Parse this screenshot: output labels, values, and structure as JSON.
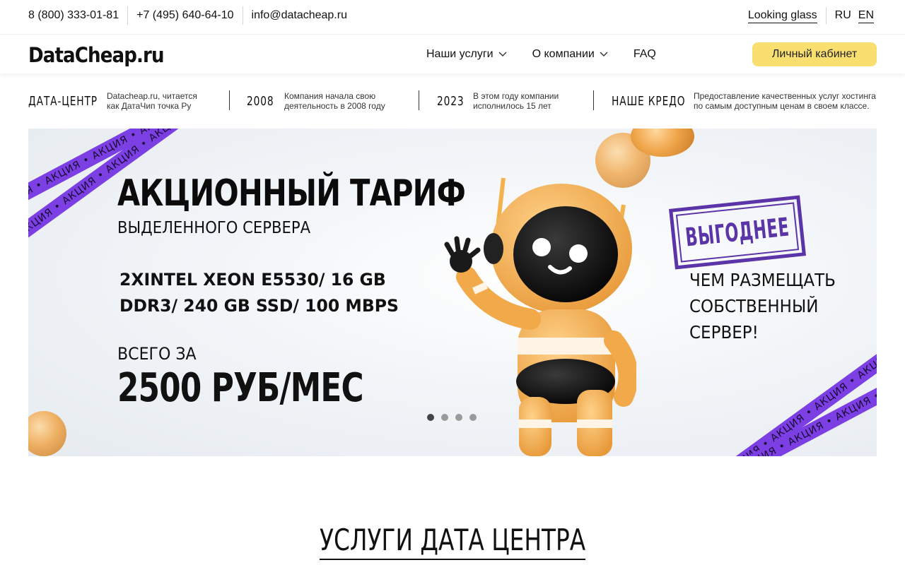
{
  "topbar": {
    "phone1": "8 (800) 333-01-81",
    "phone2": "+7 (495) 640-64-10",
    "email": "info@datacheap.ru",
    "looking_glass": "Looking glass",
    "lang_ru": "RU",
    "lang_en": "EN"
  },
  "header": {
    "logo": "DataCheap.ru",
    "nav": [
      "Наши услуги",
      "О компании",
      "FAQ"
    ],
    "cabinet_label": "Личный кабинет"
  },
  "facts": [
    {
      "big": "ДАТА-ЦЕНТР",
      "small": "Datacheap.ru, читается как ДатаЧип точка Ру"
    },
    {
      "big": "2008",
      "small": "Компания начала свою деятельность в 2008 году"
    },
    {
      "big": "2023",
      "small": "В этом году компании исполнилось 15 лет"
    },
    {
      "big": "НАШЕ КРЕДО",
      "small": "Предоставление качественных услуг хостинга по самым доступным ценам в своем классе."
    }
  ],
  "banner": {
    "title": "АКЦИОННЫЙ ТАРИФ",
    "subtitle": "ВЫДЕЛЕННОГО СЕРВЕРА",
    "spec_line1": "2XINTEL XEON E5530/ 16 GB",
    "spec_line2": "DDR3/ 240 GB SSD/ 100 MBPS",
    "price_prefix": "ВСЕГО ЗА",
    "price": "2500 РУБ/МЕС",
    "stamp": "ВЫГОДНЕЕ",
    "right_line1": "ЧЕМ РАЗМЕЩАТЬ",
    "right_line2": "СОБСТВЕННЫЙ",
    "right_line3": "СЕРВЕР!",
    "ribbon_text": "АКЦИЯ  •  АКЦИЯ  •  АКЦИЯ  •  АКЦИЯ  •  АКЦИЯ",
    "slides_total": 4,
    "slide_active": 1
  },
  "section": {
    "title": "УСЛУГИ ДАТА ЦЕНТРА"
  },
  "colors": {
    "accent_button": "#f9df70",
    "ribbon_purple": "#7b3fe4",
    "stamp_purple": "#5b35a8"
  }
}
